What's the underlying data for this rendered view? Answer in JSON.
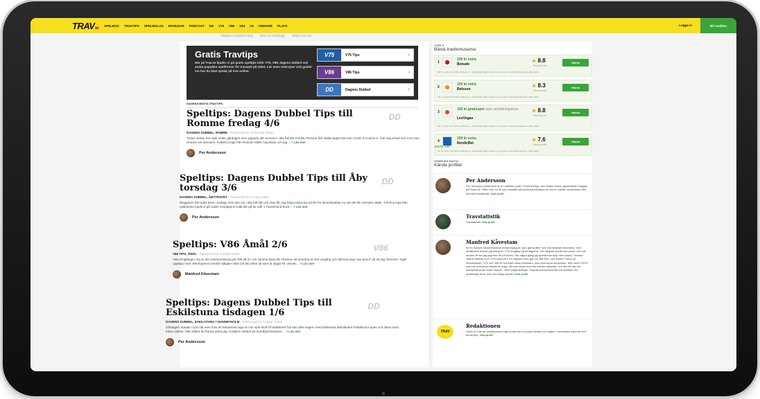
{
  "header": {
    "logo": "TRAV",
    "logo_suffix": "se",
    "nav": [
      "SPELBOK",
      "TRAVTIPS",
      "SPELBOLAG",
      "BONUSAR",
      "PODCAST",
      "DD",
      "V75",
      "V86",
      "V64",
      "V4",
      "VINNARE",
      "PLATS"
    ],
    "login": "Logga in",
    "member": "Bli medlem"
  },
  "subnav": [
    "Skapa ett spelbok idag",
    "Skriv en travblogg",
    "Jobba hos oss"
  ],
  "hero": {
    "title": "Gratis Travtips",
    "text": "Här på Trav.se bjuder vi på gratis speltips inför V75, V86, dagens dubbel och andra populära spelformer för travspel på nätet. Läs även intervjuer och guider om hur du bäst spelar på trav online.",
    "tips": [
      {
        "badge": "V75",
        "label": "V75 Tips",
        "color": "#1f5fa8"
      },
      {
        "badge": "V86",
        "label": "V86 Tips",
        "color": "#6a3d8f"
      },
      {
        "badge": "DD",
        "label": "Dagens Dubbel",
        "color": "#3b76c2"
      }
    ]
  },
  "section_title": "DAGENS BÄSTA TRAVTIPS",
  "articles": [
    {
      "title": "Speltips: Dagens Dubbel Tips till Romme fredag 4/6",
      "tag": "DD",
      "cats": "DAGENS DUBBEL, ROMME",
      "time": "Publicerad för 10 timmar sedan",
      "excerpt": "Tyvärr slokas min spik under gårdagen men lyppade ditt vinnaren i alla fall där Fredrik Persson fick stalla topptt trött men Jocke 3 Arvid E.H. Inte mig ernad och 4:43 som vinnare var lacksamt. Kvällens topp från Romme håller hög klass och jag…",
      "more": "> Läs mer",
      "author": "Per Andersson"
    },
    {
      "title": "Speltips: Dagens Dubbel Tips till Åby torsdag 3/6",
      "tag": "DD",
      "cats": "DAGENS DUBBEL, ÅBYTRAVET",
      "time": "Publicerad för en dag sedan",
      "excerpt": "Bloggaren DD-odds även i tisdags men den var i alla fall rätt och man får nog börja vänja sig vid lite för favoritstubbar nu när det blir varmare väder. Två fina lopp från vädertestn bjuds vi på under torsdagens kväll där på tur står 1 Townshend Brott…",
      "more": "> Läs mer",
      "author": "Per Andersson"
    },
    {
      "title": "Speltips: V86 Åmål 2/6",
      "tag": "V86",
      "cats": "V86 TIPS, ÅMÅL",
      "time": "Publicerad för 2 dagar sedan",
      "excerpt": "V86-Omgången. Nu är det sommarsäsong på V86 då en och samma bana får chansen att anordna en hel omgång och därmed inga 'sax-banor' på ett tag framöver. Ingel uppläpp med V86-Express innebär tidigare start (19:30) vilket så start är dagar för omsatt…",
      "more": "> Läs mer",
      "author": "Manfred Kåvestam"
    },
    {
      "title": "Speltips: Dagens Dubbel Tips till Eskilstuna tisdagen 1/6",
      "tag": "DD",
      "cats": "DAGENS DUBBEL, ESKILSTUNA / SUNDBYHOLM",
      "time": "Publicerad för 3 dagar sedan",
      "excerpt": "Gårdagen slutade i fyra rätt men trots ett fantastiskt lopp av min spik Wolf Of Wallstreet fick han dela segern med Kallenska debutanten 9 Baltimora Spav och därav bara halva oddset. Men bättre än förrast antar jag. Kvällens dubbel på Sundbyholmstrave…",
      "more": "> Läs mer",
      "author": "Per Andersson"
    }
  ],
  "sidebar": {
    "kicker": "TOPP 5",
    "heading": "Bästa travbonusarna",
    "fine": "18+ år, spela med måtta, stödlinjen.se – Erbjudandet gäller endast för nya spelare. Ansvarsfullt spelande, villkor gäller.",
    "bookmakers": [
      {
        "rank": "1",
        "bonus": "100 kr extra",
        "bonus_extra": "",
        "name": "Betsafe",
        "rating": "8.8",
        "logo_color": "#c8102e"
      },
      {
        "rank": "2",
        "bonus": "100 kr extra",
        "bonus_extra": "",
        "name": "Betsson",
        "rating": "8.3",
        "logo_color": "#f39200"
      },
      {
        "rank": "3",
        "bonus": "100 kr gratisspel",
        "bonus_extra": "utan omsättningskrav",
        "name": "LeoVegas",
        "rating": "8.8",
        "logo_color": "#e35205"
      },
      {
        "rank": "4",
        "bonus": "100 kr extra",
        "bonus_extra": "",
        "name": "NordicBet",
        "rating": "7.6",
        "logo_color": "#1b5fab"
      }
    ],
    "rating_label": "Recensioner",
    "button": "Hämta",
    "compare": "Jämför mer",
    "profiles_kicker": "SVERIGES BÄSTA",
    "profiles_heading": "Kända profiler",
    "profiles": [
      {
        "name": "Per Andersson",
        "bio": "Per 'Monopol' Andersson är en välkänd profil i Pokersverige, med bland annat uppskattade bloggar på Poker.se. Efter över 10 år som anställd på Aeverata travbana är han en inbiten travfantast med ett brett kontaktnät.",
        "link": "Visa profil"
      },
      {
        "name": "Travstatistik",
        "bio": "Travstatistik",
        "link": "Visa profil"
      },
      {
        "name": "Manfred Kåvestam",
        "bio": "Är en mycket travintresserad trebarnspappa, som gärna åker runt och besöker travbanor, men familjelivet missar jag aldrig en V75-omgång på lördagarna. Har tidigare spelat mer poker men på senare år har jag lagt mer tid på travet. Har några gång jag spelat trav ihop med andra. Senast i vintras hittade vi en V75-vinst på 2,44 miljoner som gav ca 350 000:- per andel! Fokus på streckspelen, V75 och V86 är helt klart mest intressant, med sina stora spelpooler. Men även GS75 med sin enkronas-radpris är roligt, då man tävlar med lite mindre radantal, och det blir dyrt för storspelarna att 'köpa' toppen, med helgarderingar. Hoppas kunna leverera bra speltips och andelsspel till er som vill hänga på här!",
        "link": "Visa profil"
      },
      {
        "name": "Redaktionen",
        "bio": "Detta är Trav.se-redaktionens eget konto där vi postar nyheter om sajten, information samt ett och annat tips.",
        "link": "Visa profil"
      }
    ]
  },
  "colors": {
    "accent": "#f6df1f",
    "green": "#3aa43a",
    "dark_hero": "#2b2b2b"
  }
}
